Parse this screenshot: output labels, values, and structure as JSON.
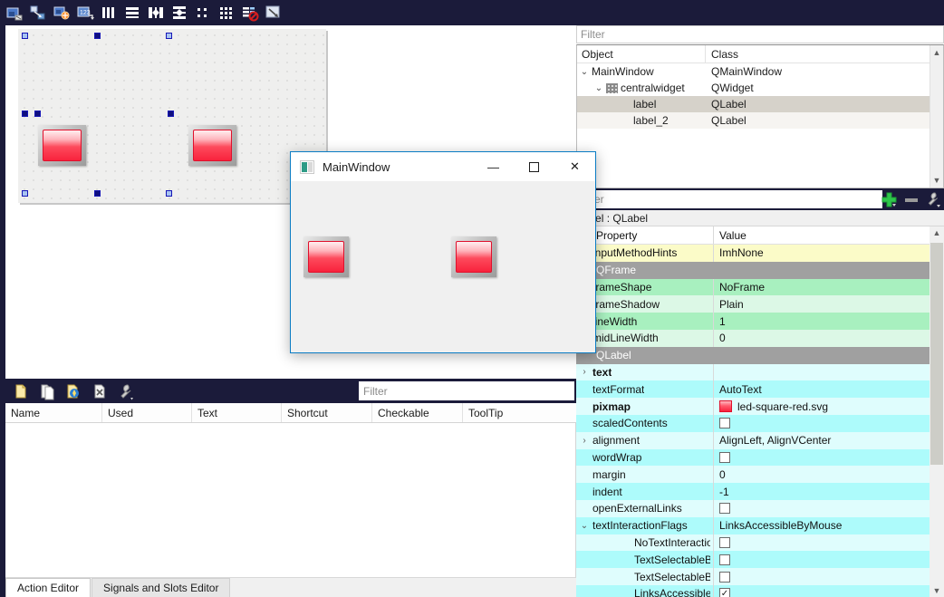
{
  "toolbar": {
    "items": [
      {
        "name": "edit-widgets-icon",
        "tip": "Edit Widgets"
      },
      {
        "name": "edit-signals-slots-icon",
        "tip": "Edit Signals/Slots"
      },
      {
        "name": "edit-buddies-icon",
        "tip": "Edit Buddies"
      },
      {
        "name": "edit-tab-order-icon",
        "tip": "Edit Tab Order"
      },
      {
        "name": "layout-horizontally-icon",
        "tip": "Lay Out Horizontally"
      },
      {
        "name": "layout-vertically-icon",
        "tip": "Lay Out Vertically"
      },
      {
        "name": "layout-splitter-horizontal-icon",
        "tip": "Lay Out Horizontally in Splitter"
      },
      {
        "name": "layout-splitter-vertical-icon",
        "tip": "Lay Out Vertically in Splitter"
      },
      {
        "name": "layout-form-icon",
        "tip": "Lay Out in a Form Layout"
      },
      {
        "name": "layout-grid-icon",
        "tip": "Lay Out in a Grid"
      },
      {
        "name": "break-layout-icon",
        "tip": "Break Layout"
      },
      {
        "name": "adjust-size-icon",
        "tip": "Adjust Size"
      }
    ]
  },
  "form": {
    "leds": [
      {
        "name": "label",
        "pixmap": "led-square-red.svg"
      },
      {
        "name": "label_2",
        "pixmap": "led-square-red.svg"
      }
    ]
  },
  "object_inspector": {
    "filter_placeholder": "Filter",
    "columns": [
      "Object",
      "Class"
    ],
    "rows": [
      {
        "object": "MainWindow",
        "class": "QMainWindow",
        "depth": 0,
        "twisty": "⌄",
        "icon": "",
        "selected": false,
        "alt": false
      },
      {
        "object": "centralwidget",
        "class": "QWidget",
        "depth": 1,
        "twisty": "⌄",
        "icon": "grid-icon",
        "selected": false,
        "alt": false
      },
      {
        "object": "label",
        "class": "QLabel",
        "depth": 2,
        "twisty": "",
        "icon": "",
        "selected": true,
        "alt": false
      },
      {
        "object": "label_2",
        "class": "QLabel",
        "depth": 2,
        "twisty": "",
        "icon": "",
        "selected": false,
        "alt": true
      }
    ]
  },
  "property_editor": {
    "filter_placeholder": "Filter",
    "add_label": "+",
    "remove_label": "–",
    "configure_name": "wrench-icon",
    "title": "label : QLabel",
    "columns": [
      "Property",
      "Value"
    ],
    "rows": [
      {
        "key": "inputMethodHints",
        "value": "ImhNone",
        "style": "yellow",
        "kind": "text",
        "twisty": "",
        "indent": 0,
        "bold": false
      },
      {
        "key": "QFrame",
        "value": "",
        "style": "group",
        "kind": "group",
        "twisty": "",
        "indent": 0,
        "bold": false
      },
      {
        "key": "frameShape",
        "value": "NoFrame",
        "style": "green1",
        "kind": "text",
        "twisty": "",
        "indent": 0,
        "bold": false
      },
      {
        "key": "frameShadow",
        "value": "Plain",
        "style": "green2",
        "kind": "text",
        "twisty": "",
        "indent": 0,
        "bold": false
      },
      {
        "key": "lineWidth",
        "value": "1",
        "style": "green1",
        "kind": "text",
        "twisty": "",
        "indent": 0,
        "bold": false
      },
      {
        "key": "midLineWidth",
        "value": "0",
        "style": "green2",
        "kind": "text",
        "twisty": "",
        "indent": 0,
        "bold": false
      },
      {
        "key": "QLabel",
        "value": "",
        "style": "group",
        "kind": "group",
        "twisty": "",
        "indent": 0,
        "bold": false
      },
      {
        "key": "text",
        "value": "",
        "style": "cyan2",
        "kind": "text",
        "twisty": "›",
        "indent": 0,
        "bold": true
      },
      {
        "key": "textFormat",
        "value": "AutoText",
        "style": "cyan1",
        "kind": "text",
        "twisty": "",
        "indent": 0,
        "bold": false
      },
      {
        "key": "pixmap",
        "value": "led-square-red.svg",
        "style": "cyan2",
        "kind": "pixmap",
        "twisty": "",
        "indent": 0,
        "bold": true
      },
      {
        "key": "scaledContents",
        "value": "",
        "style": "cyan1",
        "kind": "checkbox",
        "checked": false,
        "twisty": "",
        "indent": 0,
        "bold": false
      },
      {
        "key": "alignment",
        "value": "AlignLeft, AlignVCenter",
        "style": "cyan2",
        "kind": "text",
        "twisty": "›",
        "indent": 0,
        "bold": false
      },
      {
        "key": "wordWrap",
        "value": "",
        "style": "cyan1",
        "kind": "checkbox",
        "checked": false,
        "twisty": "",
        "indent": 0,
        "bold": false
      },
      {
        "key": "margin",
        "value": "0",
        "style": "cyan2",
        "kind": "text",
        "twisty": "",
        "indent": 0,
        "bold": false
      },
      {
        "key": "indent",
        "value": "-1",
        "style": "cyan1",
        "kind": "text",
        "twisty": "",
        "indent": 0,
        "bold": false
      },
      {
        "key": "openExternalLinks",
        "value": "",
        "style": "cyan2",
        "kind": "checkbox",
        "checked": false,
        "twisty": "",
        "indent": 0,
        "bold": false
      },
      {
        "key": "textInteractionFlags",
        "value": "LinksAccessibleByMouse",
        "style": "cyan1",
        "kind": "text",
        "twisty": "⌄",
        "indent": 0,
        "bold": false
      },
      {
        "key": "NoTextInteraction",
        "value": "",
        "style": "cyan2",
        "kind": "checkbox",
        "checked": false,
        "twisty": "",
        "indent": 2,
        "bold": false
      },
      {
        "key": "TextSelectableBy...",
        "value": "",
        "style": "cyan1",
        "kind": "checkbox",
        "checked": false,
        "twisty": "",
        "indent": 2,
        "bold": false
      },
      {
        "key": "TextSelectableBy...",
        "value": "",
        "style": "cyan2",
        "kind": "checkbox",
        "checked": false,
        "twisty": "",
        "indent": 2,
        "bold": false
      },
      {
        "key": "LinksAccessibleB...",
        "value": "",
        "style": "cyan1",
        "kind": "checkbox",
        "checked": true,
        "twisty": "",
        "indent": 2,
        "bold": false
      }
    ]
  },
  "action_editor": {
    "filter_placeholder": "Filter",
    "toolbar_items": [
      {
        "name": "new-action-icon"
      },
      {
        "name": "copy-action-icon"
      },
      {
        "name": "edit-action-icon"
      },
      {
        "name": "delete-action-icon"
      },
      {
        "name": "configure-action-icon"
      }
    ],
    "columns": [
      "Name",
      "Used",
      "Text",
      "Shortcut",
      "Checkable",
      "ToolTip"
    ],
    "rows": []
  },
  "dock_tabs": [
    {
      "label": "Action Editor",
      "active": true
    },
    {
      "label": "Signals and Slots Editor",
      "active": false
    }
  ],
  "preview_window": {
    "title": "MainWindow",
    "minimize_label": "—",
    "maximize_label": "☐",
    "close_label": "✕",
    "leds": [
      {
        "name": "label"
      },
      {
        "name": "label_2"
      }
    ]
  }
}
